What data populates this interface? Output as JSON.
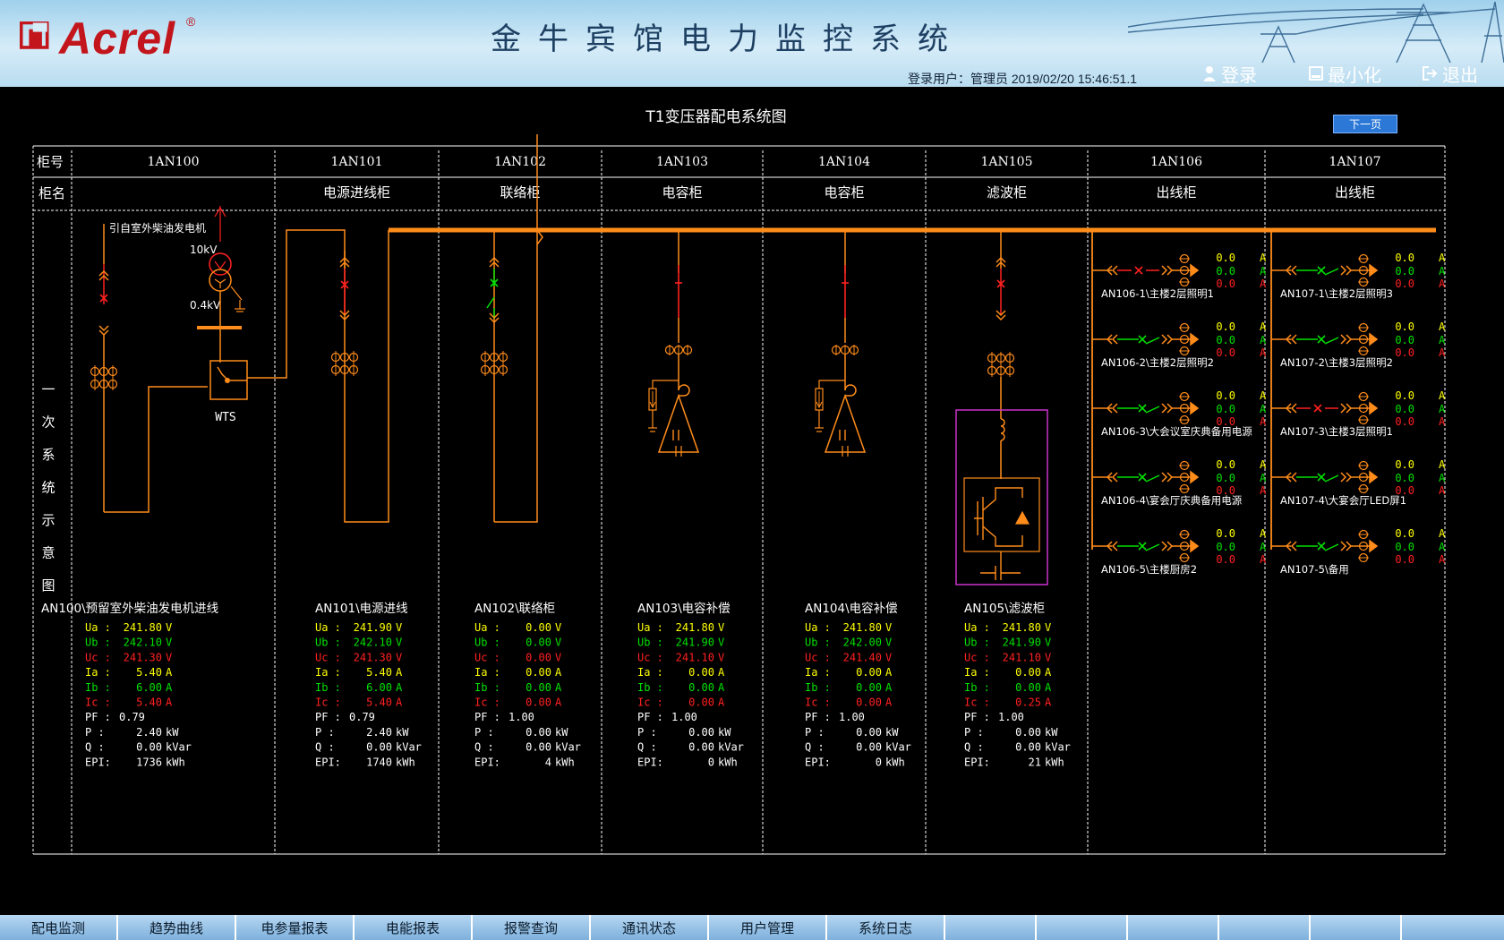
{
  "header": {
    "logo_text": "Acrel",
    "logo_reg": "®",
    "title": "金牛宾馆电力监控系统",
    "user_info": "登录用户：管理员   2019/02/20  15:46:51.1",
    "login": "登录",
    "minimize": "最小化",
    "exit": "退出"
  },
  "diagram": {
    "title": "T1变压器配电系统图",
    "next_page": "下一页",
    "row_label_number": "柜号",
    "row_label_name": "柜名",
    "side_label": [
      "一",
      "次",
      "系",
      "统",
      "示",
      "意",
      "图"
    ],
    "cabinet_numbers": [
      "1AN100",
      "1AN101",
      "1AN102",
      "1AN103",
      "1AN104",
      "1AN105",
      "1AN106",
      "1AN107"
    ],
    "cabinet_names": [
      "",
      "电源进线柜",
      "联络柜",
      "电容柜",
      "电容柜",
      "滤波柜",
      "出线柜",
      "出线柜"
    ],
    "generator_label": "引自室外柴油发电机",
    "hv_label": "10kV",
    "lv_label": "0.4kV",
    "wts_label": "WTS"
  },
  "meters": [
    {
      "title": "AN100\\预留室外柴油发电机进线",
      "ua": "241.80 V",
      "ub": "242.10 V",
      "uc": "241.30 V",
      "ia": "5.40 A",
      "ib": "6.00 A",
      "ic": "5.40 A",
      "pf": "0.79",
      "p": "2.40 kW",
      "q": "0.00 kVar",
      "epi": "1736 kWh"
    },
    {
      "title": "AN101\\电源进线",
      "ua": "241.90 V",
      "ub": "242.10 V",
      "uc": "241.30 V",
      "ia": "5.40 A",
      "ib": "6.00 A",
      "ic": "5.40 A",
      "pf": "0.79",
      "p": "2.40 kW",
      "q": "0.00 kVar",
      "epi": "1740 kWh"
    },
    {
      "title": "AN102\\联络柜",
      "ua": "0.00 V",
      "ub": "0.00 V",
      "uc": "0.00 V",
      "ia": "0.00 A",
      "ib": "0.00 A",
      "ic": "0.00 A",
      "pf": "1.00",
      "p": "0.00 kW",
      "q": "0.00 kVar",
      "epi": "4 kWh"
    },
    {
      "title": "AN103\\电容补偿",
      "ua": "241.80 V",
      "ub": "241.90 V",
      "uc": "241.10 V",
      "ia": "0.00 A",
      "ib": "0.00 A",
      "ic": "0.00 A",
      "pf": "1.00",
      "p": "0.00 kW",
      "q": "0.00 kVar",
      "epi": "0 kWh"
    },
    {
      "title": "AN104\\电容补偿",
      "ua": "241.80 V",
      "ub": "242.00 V",
      "uc": "241.40 V",
      "ia": "0.00 A",
      "ib": "0.00 A",
      "ic": "0.00 A",
      "pf": "1.00",
      "p": "0.00 kW",
      "q": "0.00 kVar",
      "epi": "0 kWh"
    },
    {
      "title": "AN105\\滤波柜",
      "ua": "241.80 V",
      "ub": "241.90 V",
      "uc": "241.10 V",
      "ia": "0.00 A",
      "ib": "0.00 A",
      "ic": "0.25 A",
      "pf": "1.00",
      "p": "0.00 kW",
      "q": "0.00 kVar",
      "epi": "21 kWh"
    }
  ],
  "meter_labels": {
    "ua": "Ua :",
    "ub": "Ub :",
    "uc": "Uc :",
    "ia": "Ia :",
    "ib": "Ib :",
    "ic": "Ic :",
    "pf": "PF :",
    "p": "P  :",
    "q": "Q  :",
    "epi": "EPI:"
  },
  "feeders_106": [
    {
      "name": "AN106-1\\主楼2层照明1",
      "a": "0.0",
      "b": "0.0",
      "c": "0.0",
      "unit": "A",
      "switch": "open"
    },
    {
      "name": "AN106-2\\主楼2层照明2",
      "a": "0.0",
      "b": "0.0",
      "c": "0.0",
      "unit": "A",
      "switch": "closed"
    },
    {
      "name": "AN106-3\\大会议室庆典备用电源",
      "a": "0.0",
      "b": "0.0",
      "c": "0.0",
      "unit": "A",
      "switch": "closed"
    },
    {
      "name": "AN106-4\\宴会厅庆典备用电源",
      "a": "0.0",
      "b": "0.0",
      "c": "0.0",
      "unit": "A",
      "switch": "closed"
    },
    {
      "name": "AN106-5\\主楼厨房2",
      "a": "0.0",
      "b": "0.0",
      "c": "0.0",
      "unit": "A",
      "switch": "closed"
    }
  ],
  "feeders_107": [
    {
      "name": "AN107-1\\主楼2层照明3",
      "a": "0.0",
      "b": "0.0",
      "c": "0.0",
      "unit": "A",
      "switch": "closed"
    },
    {
      "name": "AN107-2\\主楼3层照明2",
      "a": "0.0",
      "b": "0.0",
      "c": "0.0",
      "unit": "A",
      "switch": "closed"
    },
    {
      "name": "AN107-3\\主楼3层照明1",
      "a": "0.0",
      "b": "0.0",
      "c": "0.0",
      "unit": "A",
      "switch": "open"
    },
    {
      "name": "AN107-4\\大宴会厅LED屏1",
      "a": "0.0",
      "b": "0.0",
      "c": "0.0",
      "unit": "A",
      "switch": "closed"
    },
    {
      "name": "AN107-5\\备用",
      "a": "0.0",
      "b": "0.0",
      "c": "0.0",
      "unit": "A",
      "switch": "closed"
    }
  ],
  "colors": {
    "bus": "#ff8c1a",
    "phase_a": "#ffff00",
    "phase_b": "#00e000",
    "phase_c": "#ff2020",
    "open": "#ff2020",
    "closed": "#00e000",
    "grid": "#ffffff",
    "filter_box": "#cc33cc"
  },
  "footer": {
    "tabs": [
      "配电监测",
      "趋势曲线",
      "电参量报表",
      "电能报表",
      "报警查询",
      "通讯状态",
      "用户管理",
      "系统日志"
    ]
  }
}
